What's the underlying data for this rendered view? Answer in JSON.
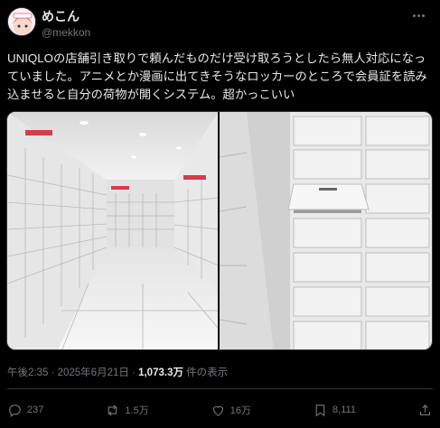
{
  "author": {
    "display_name": "めこん",
    "handle": "@mekkon"
  },
  "tweet": {
    "text": "UNIQLOの店舗引き取りで頼んだものだけ受け取ろうとしたら無人対応になっていました。アニメとか漫画に出てきそうなロッカーのところで会員証を読み込ませると自分の荷物が開くシステム。超かっこいい",
    "time": "午後2:35 · 2025年6月21日 · ",
    "views_count": "1,073.3万",
    "views_label": " 件の表示"
  },
  "media": [
    {
      "icon": "locker-corridor-photo"
    },
    {
      "icon": "open-locker-photo"
    }
  ],
  "actions": {
    "replies": "237",
    "reposts": "1.5万",
    "likes": "16万",
    "bookmarks": "8,111"
  }
}
